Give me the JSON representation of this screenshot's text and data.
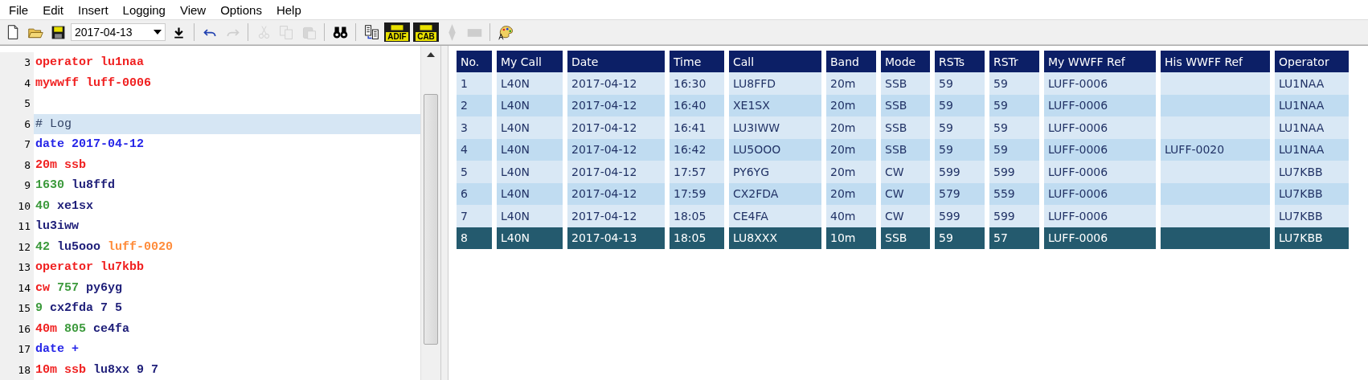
{
  "menu": [
    "File",
    "Edit",
    "Insert",
    "Logging",
    "View",
    "Options",
    "Help"
  ],
  "toolbar": {
    "buttons": [
      {
        "kind": "new",
        "disabled": false
      },
      {
        "kind": "open",
        "disabled": false
      },
      {
        "kind": "save",
        "disabled": false
      },
      {
        "kind": "date"
      },
      {
        "kind": "download",
        "disabled": false
      },
      {
        "kind": "sep"
      },
      {
        "kind": "undo",
        "disabled": false
      },
      {
        "kind": "redo",
        "disabled": true
      },
      {
        "kind": "sep"
      },
      {
        "kind": "cut",
        "disabled": true
      },
      {
        "kind": "copy",
        "disabled": true
      },
      {
        "kind": "paste",
        "disabled": true
      },
      {
        "kind": "sep"
      },
      {
        "kind": "find",
        "disabled": false
      },
      {
        "kind": "sep"
      },
      {
        "kind": "export",
        "disabled": false
      },
      {
        "kind": "adif",
        "disabled": false,
        "label": "ADIF"
      },
      {
        "kind": "cab",
        "disabled": false,
        "label": "CAB"
      },
      {
        "kind": "diamond",
        "disabled": true
      },
      {
        "kind": "bar",
        "disabled": true
      },
      {
        "kind": "sep"
      },
      {
        "kind": "palette",
        "disabled": false
      }
    ],
    "date": "2017-04-13"
  },
  "editor": {
    "lines": [
      {
        "number": "3",
        "selected": false,
        "tokens": [
          {
            "kind": "keyword",
            "text": "operator"
          },
          {
            "kind": "keyword",
            "text": "lu1naa"
          }
        ]
      },
      {
        "number": "4",
        "selected": false,
        "tokens": [
          {
            "kind": "keyword",
            "text": "mywwff"
          },
          {
            "kind": "keyword",
            "text": "luff-0006"
          }
        ]
      },
      {
        "number": "5",
        "selected": false
      },
      {
        "number": "6",
        "selected": true,
        "tokens": [
          {
            "kind": "comment",
            "text": "# Log"
          }
        ]
      },
      {
        "number": "7",
        "selected": false,
        "tokens": [
          {
            "kind": "date",
            "text": "date"
          },
          {
            "kind": "date",
            "text": "2017-04-12"
          }
        ]
      },
      {
        "number": "8",
        "selected": false,
        "tokens": [
          {
            "kind": "keyword",
            "text": "20m"
          },
          {
            "kind": "keyword",
            "text": "ssb"
          }
        ]
      },
      {
        "number": "9",
        "selected": false,
        "tokens": [
          {
            "kind": "number",
            "text": "1630"
          },
          {
            "kind": "call",
            "text": "lu8ffd"
          }
        ]
      },
      {
        "number": "10",
        "selected": false,
        "tokens": [
          {
            "kind": "number",
            "text": "40"
          },
          {
            "kind": "call",
            "text": "xe1sx"
          }
        ]
      },
      {
        "number": "11",
        "selected": false,
        "tokens": [
          {
            "kind": "call",
            "text": "lu3iww"
          }
        ]
      },
      {
        "number": "12",
        "selected": false,
        "tokens": [
          {
            "kind": "number",
            "text": "42"
          },
          {
            "kind": "call",
            "text": "lu5ooo"
          },
          {
            "kind": "ref",
            "text": "luff-0020"
          }
        ]
      },
      {
        "number": "13",
        "selected": false,
        "tokens": [
          {
            "kind": "keyword",
            "text": "operator"
          },
          {
            "kind": "keyword",
            "text": "lu7kbb"
          }
        ]
      },
      {
        "number": "14",
        "selected": false,
        "tokens": [
          {
            "kind": "keyword",
            "text": "cw"
          },
          {
            "kind": "number",
            "text": "757"
          },
          {
            "kind": "call",
            "text": "py6yg"
          }
        ]
      },
      {
        "number": "15",
        "selected": false,
        "tokens": [
          {
            "kind": "number",
            "text": "9"
          },
          {
            "kind": "call",
            "text": "cx2fda"
          },
          {
            "kind": "call",
            "text": "7 5"
          }
        ]
      },
      {
        "number": "16",
        "selected": false,
        "tokens": [
          {
            "kind": "keyword",
            "text": "40m"
          },
          {
            "kind": "number",
            "text": "805"
          },
          {
            "kind": "call",
            "text": "ce4fa"
          }
        ]
      },
      {
        "number": "17",
        "selected": false,
        "tokens": [
          {
            "kind": "date",
            "text": "date"
          },
          {
            "kind": "date",
            "text": "+"
          }
        ]
      },
      {
        "number": "18",
        "selected": false,
        "tokens": [
          {
            "kind": "keyword",
            "text": "10m"
          },
          {
            "kind": "keyword",
            "text": "ssb"
          },
          {
            "kind": "call",
            "text": "lu8xx"
          },
          {
            "kind": "call",
            "text": "9 7"
          }
        ]
      }
    ]
  },
  "table": {
    "columns": [
      "No.",
      "My Call",
      "Date",
      "Time",
      "Call",
      "Band",
      "Mode",
      "RSTs",
      "RSTr",
      "My WWFF Ref",
      "His WWFF Ref",
      "Operator"
    ],
    "rows": [
      {
        "selected": false,
        "cells": [
          "1",
          "L40N",
          "2017-04-12",
          "16:30",
          "LU8FFD",
          "20m",
          "SSB",
          "59",
          "59",
          "LUFF-0006",
          "",
          "LU1NAA"
        ]
      },
      {
        "selected": false,
        "cells": [
          "2",
          "L40N",
          "2017-04-12",
          "16:40",
          "XE1SX",
          "20m",
          "SSB",
          "59",
          "59",
          "LUFF-0006",
          "",
          "LU1NAA"
        ]
      },
      {
        "selected": false,
        "cells": [
          "3",
          "L40N",
          "2017-04-12",
          "16:41",
          "LU3IWW",
          "20m",
          "SSB",
          "59",
          "59",
          "LUFF-0006",
          "",
          "LU1NAA"
        ]
      },
      {
        "selected": false,
        "cells": [
          "4",
          "L40N",
          "2017-04-12",
          "16:42",
          "LU5OOO",
          "20m",
          "SSB",
          "59",
          "59",
          "LUFF-0006",
          "LUFF-0020",
          "LU1NAA"
        ]
      },
      {
        "selected": false,
        "cells": [
          "5",
          "L40N",
          "2017-04-12",
          "17:57",
          "PY6YG",
          "20m",
          "CW",
          "599",
          "599",
          "LUFF-0006",
          "",
          "LU7KBB"
        ]
      },
      {
        "selected": false,
        "cells": [
          "6",
          "L40N",
          "2017-04-12",
          "17:59",
          "CX2FDA",
          "20m",
          "CW",
          "579",
          "559",
          "LUFF-0006",
          "",
          "LU7KBB"
        ]
      },
      {
        "selected": false,
        "cells": [
          "7",
          "L40N",
          "2017-04-12",
          "18:05",
          "CE4FA",
          "40m",
          "CW",
          "599",
          "599",
          "LUFF-0006",
          "",
          "LU7KBB"
        ]
      },
      {
        "selected": true,
        "cells": [
          "8",
          "L40N",
          "2017-04-13",
          "18:05",
          "LU8XXX",
          "10m",
          "SSB",
          "59",
          "57",
          "LUFF-0006",
          "",
          "LU7KBB"
        ]
      }
    ]
  }
}
